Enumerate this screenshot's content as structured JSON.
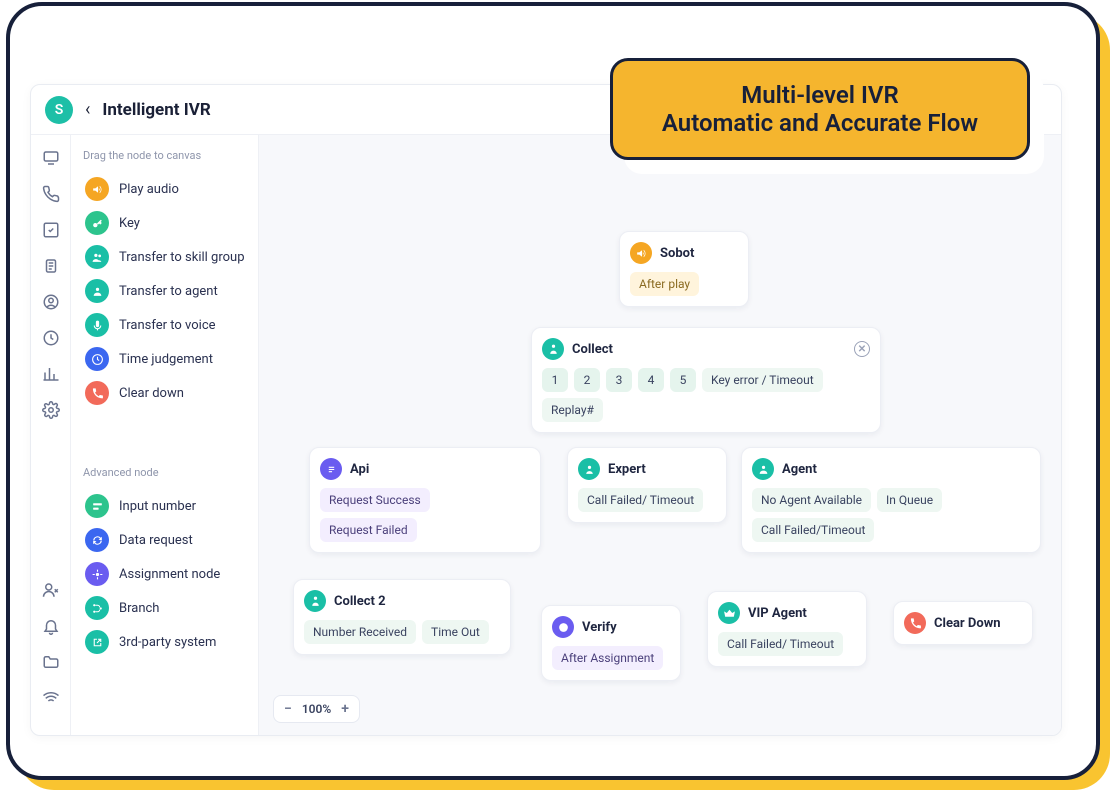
{
  "header": {
    "avatar_letter": "S",
    "title": "Intelligent IVR"
  },
  "callout": {
    "line1": "Multi-level IVR",
    "line2": "Automatic and Accurate Flow"
  },
  "palette": {
    "hint": "Drag the node to canvas",
    "basic": [
      {
        "label": "Play audio",
        "color": "orange",
        "icon": "sound"
      },
      {
        "label": "Key",
        "color": "green",
        "icon": "key"
      },
      {
        "label": "Transfer to skill group",
        "color": "teal",
        "icon": "group"
      },
      {
        "label": "Transfer to agent",
        "color": "teal",
        "icon": "agent"
      },
      {
        "label": "Transfer to voice",
        "color": "teal",
        "icon": "voice"
      },
      {
        "label": "Time judgement",
        "color": "blue",
        "icon": "clock"
      },
      {
        "label": "Clear down",
        "color": "red",
        "icon": "hangup"
      }
    ],
    "advanced_hint": "Advanced node",
    "advanced": [
      {
        "label": "Input number",
        "color": "green",
        "icon": "input"
      },
      {
        "label": "Data request",
        "color": "blue",
        "icon": "data"
      },
      {
        "label": "Assignment node",
        "color": "violet",
        "icon": "assign"
      },
      {
        "label": "Branch",
        "color": "teal",
        "icon": "branch"
      },
      {
        "label": "3rd-party system",
        "color": "teal",
        "icon": "export"
      }
    ]
  },
  "zoom": {
    "level": "100%"
  },
  "nodes": {
    "sobot": {
      "title": "Sobot",
      "after": "After play"
    },
    "collect": {
      "title": "Collect",
      "keys": [
        "1",
        "2",
        "3",
        "4",
        "5"
      ],
      "extra": [
        "Key error / Timeout",
        "Replay#"
      ]
    },
    "api": {
      "title": "Api",
      "chips": [
        "Request Success",
        "Request Failed"
      ]
    },
    "expert": {
      "title": "Expert",
      "chips": [
        "Call Failed/ Timeout"
      ]
    },
    "agent": {
      "title": "Agent",
      "chips": [
        "No Agent Available",
        "In Queue",
        "Call Failed/Timeout"
      ]
    },
    "collect2": {
      "title": "Collect 2",
      "chips": [
        "Number Received",
        "Time Out"
      ]
    },
    "verify": {
      "title": "Verify",
      "chips": [
        "After Assignment"
      ]
    },
    "vip": {
      "title": "VIP Agent",
      "chips": [
        "Call Failed/ Timeout"
      ]
    },
    "cleardown": {
      "title": "Clear Down"
    }
  }
}
